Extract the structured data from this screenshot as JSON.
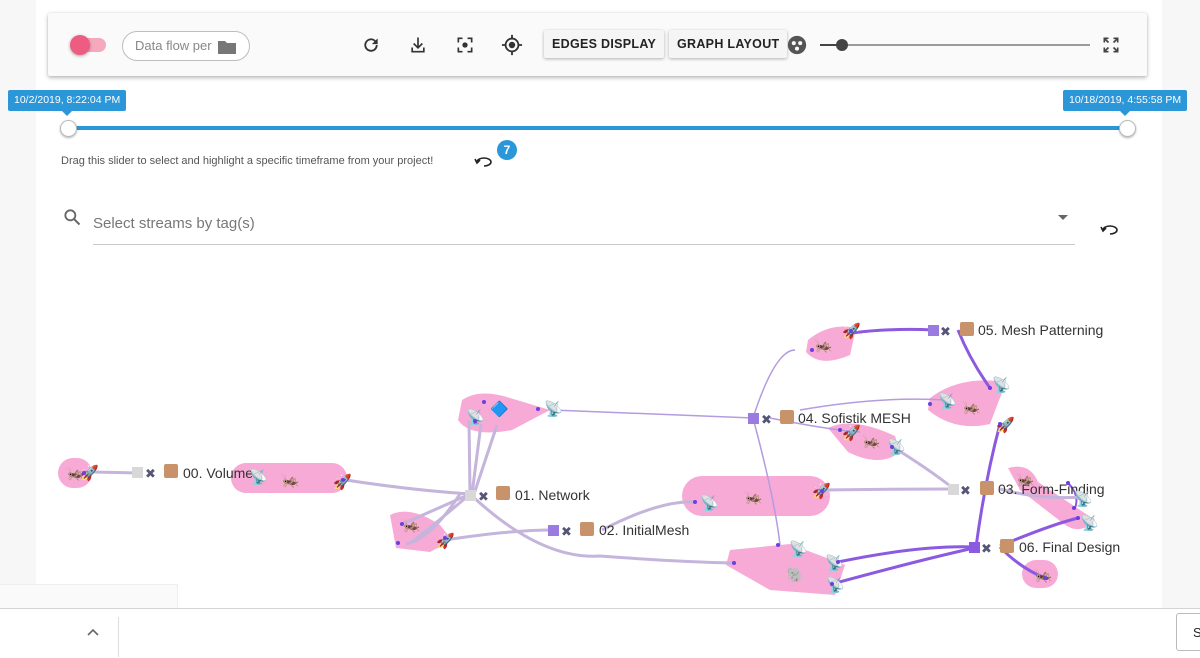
{
  "toolbar": {
    "flow_chip_label": "Data flow per",
    "edges_display_label": "EDGES DISPLAY",
    "graph_layout_label": "GRAPH LAYOUT",
    "zoom_value": 0.08
  },
  "timeframe": {
    "start_label": "10/2/2019, 8:22:04 PM",
    "end_label": "10/18/2019, 4:55:58 PM",
    "hint": "Drag this slider to select and highlight a specific timeframe from your project!",
    "badge_count": "7"
  },
  "tag_search": {
    "placeholder": "Select streams by tag(s)"
  },
  "streams": [
    "00. Volume",
    "01. Network",
    "02. InitialMesh",
    "03. Form-Finding",
    "04. Sofistik MESH",
    "05. Mesh Patterning",
    "06. Final Design"
  ],
  "bottom": {
    "corner_tab_label": "S"
  },
  "colors": {
    "accent": "#2b96d8",
    "toggle": "#ef5c82",
    "blob": "#f8aad6",
    "edge_light": "#c5b4dc",
    "edge_dark": "#8b5ae0",
    "stream_node": "#9a7be0"
  }
}
